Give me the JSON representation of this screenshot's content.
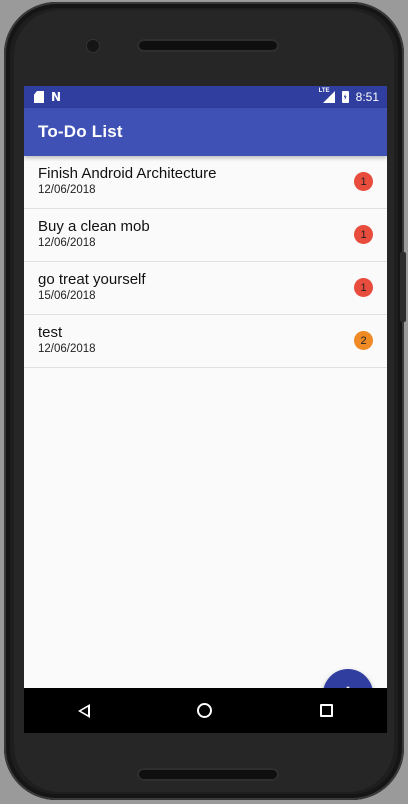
{
  "status_bar": {
    "time": "8:51",
    "network_label": "LTE",
    "left_icons": [
      "sd-card-icon",
      "n-notification-icon"
    ],
    "right_icons": [
      "lte-signal-icon",
      "battery-charging-icon"
    ]
  },
  "app_bar": {
    "title": "To-Do List",
    "color": "#3f51b5",
    "status_color": "#303f9f"
  },
  "tasks": [
    {
      "title": "Finish Android Architecture",
      "date": "12/06/2018",
      "priority": "1",
      "priority_color": "#e84c3d"
    },
    {
      "title": "Buy a clean mob",
      "date": "12/06/2018",
      "priority": "1",
      "priority_color": "#e84c3d"
    },
    {
      "title": "go treat yourself",
      "date": "15/06/2018",
      "priority": "1",
      "priority_color": "#e84c3d"
    },
    {
      "title": "test",
      "date": "12/06/2018",
      "priority": "2",
      "priority_color": "#f08a24"
    }
  ],
  "fab": {
    "icon": "plus-icon",
    "label": "+"
  },
  "nav_bar": {
    "icons": [
      "back-icon",
      "home-icon",
      "recents-icon"
    ]
  }
}
